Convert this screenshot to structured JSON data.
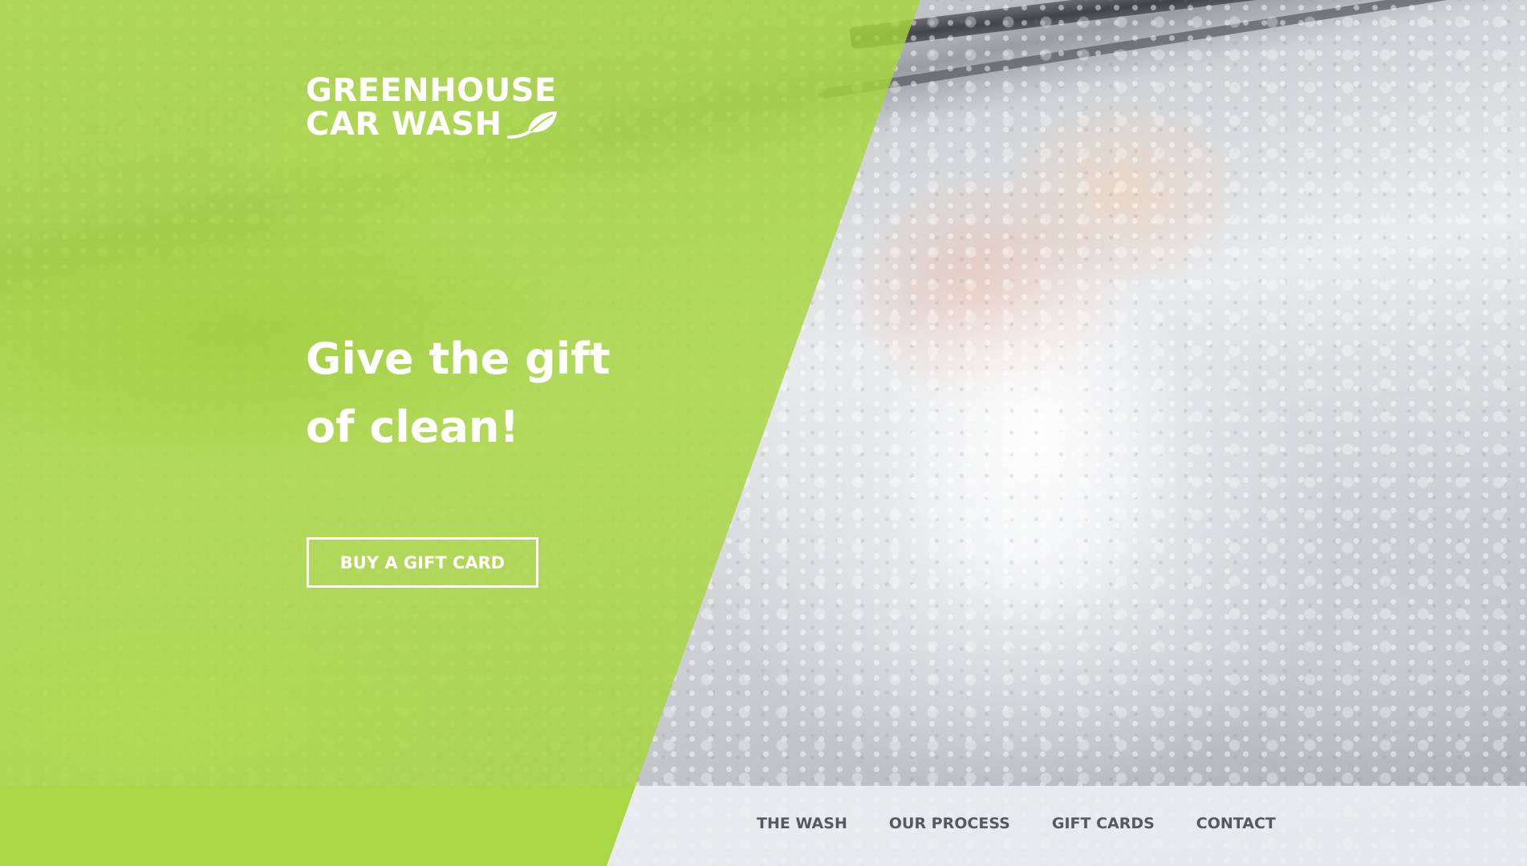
{
  "brand": {
    "line1": "GREENHOUSE",
    "line2": "CAR WASH",
    "logo_icon": "leaf-icon"
  },
  "hero": {
    "headline_line1": "Give the gift",
    "headline_line2": "of clean!",
    "cta_label": "BUY A GIFT CARD"
  },
  "nav": {
    "items": [
      {
        "label": "THE WASH"
      },
      {
        "label": "OUR PROCESS"
      },
      {
        "label": "GIFT CARDS"
      },
      {
        "label": "CONTACT"
      }
    ]
  },
  "colors": {
    "brand_green": "#a6d63c",
    "text_white": "#ffffff",
    "nav_text": "#555a60",
    "nav_bg": "#eef0f2"
  }
}
